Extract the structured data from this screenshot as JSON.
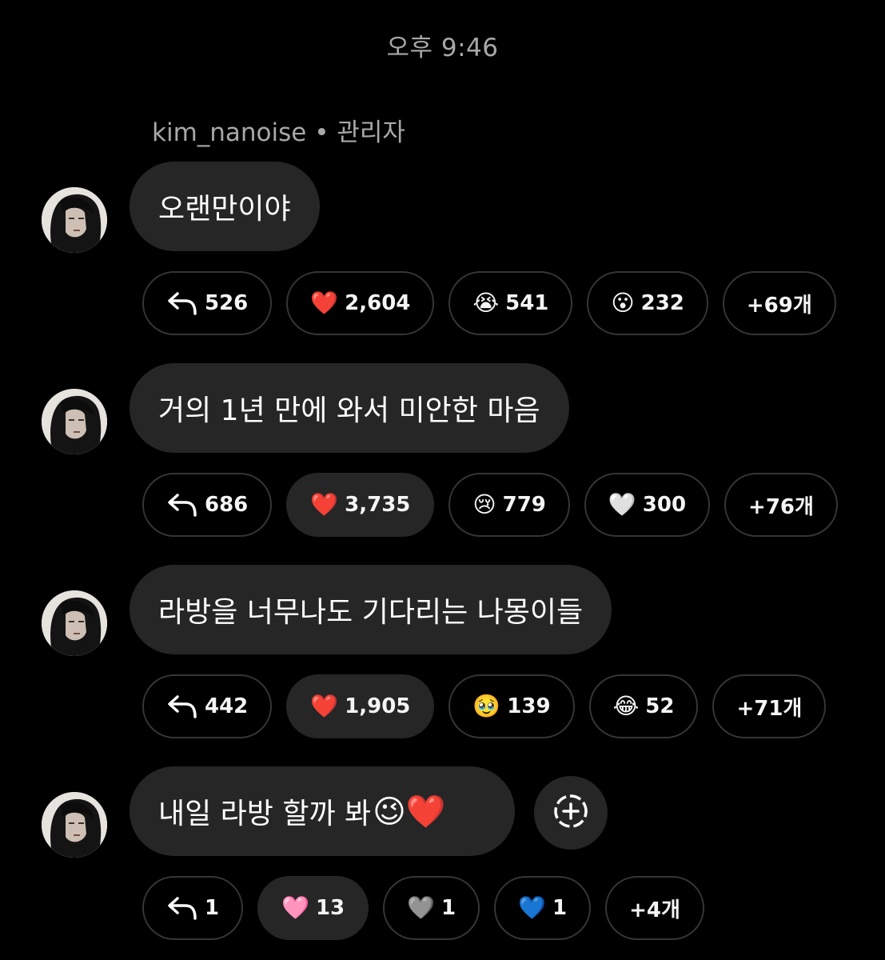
{
  "status_time": "오후 9:46",
  "sender": {
    "username": "kim_nanoise",
    "separator": "•",
    "role": "관리자"
  },
  "messages": [
    {
      "text": "오랜만이야",
      "emoji": "",
      "replies": "526",
      "reactions": [
        {
          "emoji": "❤️",
          "count": "2,604",
          "active": false
        },
        {
          "emoji": "😭",
          "count": "541",
          "active": false
        },
        {
          "emoji": "😮",
          "count": "232",
          "active": false
        }
      ],
      "more": "+69개"
    },
    {
      "text": "거의 1년 만에 와서 미안한 마음",
      "emoji": "",
      "replies": "686",
      "reactions": [
        {
          "emoji": "❤️",
          "count": "3,735",
          "active": true
        },
        {
          "emoji": "😢",
          "count": "779",
          "active": false
        },
        {
          "emoji": "🤍",
          "count": "300",
          "active": false
        }
      ],
      "more": "+76개"
    },
    {
      "text": "라방을 너무나도 기다리는 나몽이들",
      "emoji": "",
      "replies": "442",
      "reactions": [
        {
          "emoji": "❤️",
          "count": "1,905",
          "active": true
        },
        {
          "emoji": "🥹",
          "count": "139",
          "active": false
        },
        {
          "emoji": "😂",
          "count": "52",
          "active": false
        }
      ],
      "more": "+71개"
    },
    {
      "text": "내일 라방 할까 봐",
      "emoji": "😉❤️",
      "replies": "1",
      "reactions": [
        {
          "emoji": "🩷",
          "count": "13",
          "active": true
        },
        {
          "emoji": "🩶",
          "count": "1",
          "active": false
        },
        {
          "emoji": "💙",
          "count": "1",
          "active": false
        }
      ],
      "more": "+4개"
    }
  ],
  "icons": {
    "reply": "reply-arrow-icon",
    "add_reaction": "add-reaction-icon"
  }
}
